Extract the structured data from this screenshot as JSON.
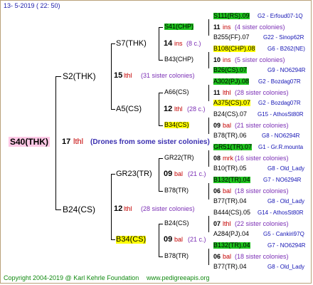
{
  "header": "13-  5-2019 (  22:  50)",
  "footer": {
    "copyright": "Copyright 2004-2019 @ Karl Kehrle Foundation",
    "url": "www.pedigreeapis.org"
  },
  "root": {
    "name": "S40(THK)",
    "num": "17",
    "breeder": "lthl",
    "note": "(Drones from some sister colonies)"
  },
  "gen1": [
    {
      "name": "S2(THK)",
      "num": "15",
      "breeder": "lthl",
      "sisters": "(31 sister colonies)"
    },
    {
      "name": "B24(CS)",
      "num": "12",
      "breeder": "lthl",
      "sisters": "(28 sister colonies)"
    }
  ],
  "gen2": [
    {
      "name": "S7(THK)",
      "num": "14",
      "breeder": "ins",
      "sisters": "(8 c.)"
    },
    {
      "name": "A5(CS)",
      "num": "12",
      "breeder": "lthl",
      "sisters": "(28 c.)"
    },
    {
      "name": "GR23(TR)",
      "num": "09",
      "breeder": "bal",
      "sisters": "(21 c.)"
    },
    {
      "name": "B34(CS)",
      "num": "09",
      "breeder": "bal",
      "sisters": "(21 c.)"
    }
  ],
  "gen3": [
    {
      "name": "S41(CHP)",
      "num": "11",
      "breeder": "ins",
      "sisters": "(4 sister colonies)"
    },
    {
      "name": "B43(CHP)",
      "num": "10",
      "breeder": "ins",
      "sisters": "(5 sister colonies)"
    },
    {
      "name": "A66(CS)",
      "num": "11",
      "breeder": "lthl",
      "sisters": "(28 sister colonies)"
    },
    {
      "name": "B34(CS)",
      "num": "09",
      "breeder": "bal",
      "sisters": "(21 sister colonies)"
    },
    {
      "name": "GR22(TR)",
      "num": "08",
      "breeder": "mrk",
      "sisters": "(16 sister colonies)"
    },
    {
      "name": "B78(TR)",
      "num": "06",
      "breeder": "bal",
      "sisters": "(18 sister colonies)"
    },
    {
      "name": "B24(CS)",
      "num": "07",
      "breeder": "lthl",
      "sisters": "(22 sister colonies)"
    },
    {
      "name": "B78(TR)",
      "num": "06",
      "breeder": "bal",
      "sisters": "(18 sister colonies)"
    }
  ],
  "gen4": [
    {
      "name": "S111(RS).09",
      "origin": "G2 - Erfoud07-1Q"
    },
    {
      "name": "B255(FF).07",
      "origin": "G22 - Sinop62R"
    },
    {
      "name": "B108(CHP).08",
      "origin": "G6 - B262(NE)"
    },
    {
      "name": "B26(CS).07",
      "origin": "G9 - NO6294R"
    },
    {
      "name": "A302(PJ).08",
      "origin": "G2 - Bozdag07R"
    },
    {
      "name": "A375(CS).07",
      "origin": "G2 - Bozdag07R"
    },
    {
      "name": "B24(CS).07",
      "origin": "G15 - AthosSt80R"
    },
    {
      "name": "B78(TR).06",
      "origin": "G8 - NO6294R"
    },
    {
      "name": "GR51(TR).07",
      "origin": "G1 - Gr.R.mounta"
    },
    {
      "name": "B10(TR).05",
      "origin": "G8 - Old_Lady"
    },
    {
      "name": "B132(TR).04",
      "origin": "G7 - NO6294R"
    },
    {
      "name": "B77(TR).04",
      "origin": "G8 - Old_Lady"
    },
    {
      "name": "B444(CS).05",
      "origin": "G14 - AthosSt80R"
    },
    {
      "name": "A284(PJ).04",
      "origin": "G5 - Cankiri97Q"
    },
    {
      "name": "B132(TR).04",
      "origin": "G7 - NO6294R"
    },
    {
      "name": "B77(TR).04",
      "origin": "G8 - Old_Lady"
    }
  ]
}
